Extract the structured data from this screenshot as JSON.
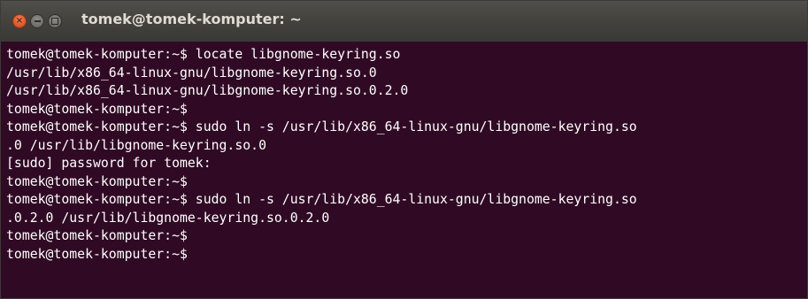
{
  "window": {
    "title": "tomek@tomek-komputer: ~",
    "buttons": {
      "close_glyph": "×",
      "minimize_icon": "minimize-icon",
      "maximize_icon": "maximize-icon"
    }
  },
  "terminal": {
    "background": "#300a24",
    "foreground": "#ffffff",
    "lines": [
      "tomek@tomek-komputer:~$ locate libgnome-keyring.so",
      "/usr/lib/x86_64-linux-gnu/libgnome-keyring.so.0",
      "/usr/lib/x86_64-linux-gnu/libgnome-keyring.so.0.2.0",
      "tomek@tomek-komputer:~$",
      "tomek@tomek-komputer:~$ sudo ln -s /usr/lib/x86_64-linux-gnu/libgnome-keyring.so",
      ".0 /usr/lib/libgnome-keyring.so.0",
      "[sudo] password for tomek:",
      "tomek@tomek-komputer:~$",
      "tomek@tomek-komputer:~$ sudo ln -s /usr/lib/x86_64-linux-gnu/libgnome-keyring.so",
      ".0.2.0 /usr/lib/libgnome-keyring.so.0.2.0",
      "tomek@tomek-komputer:~$",
      "tomek@tomek-komputer:~$"
    ]
  }
}
